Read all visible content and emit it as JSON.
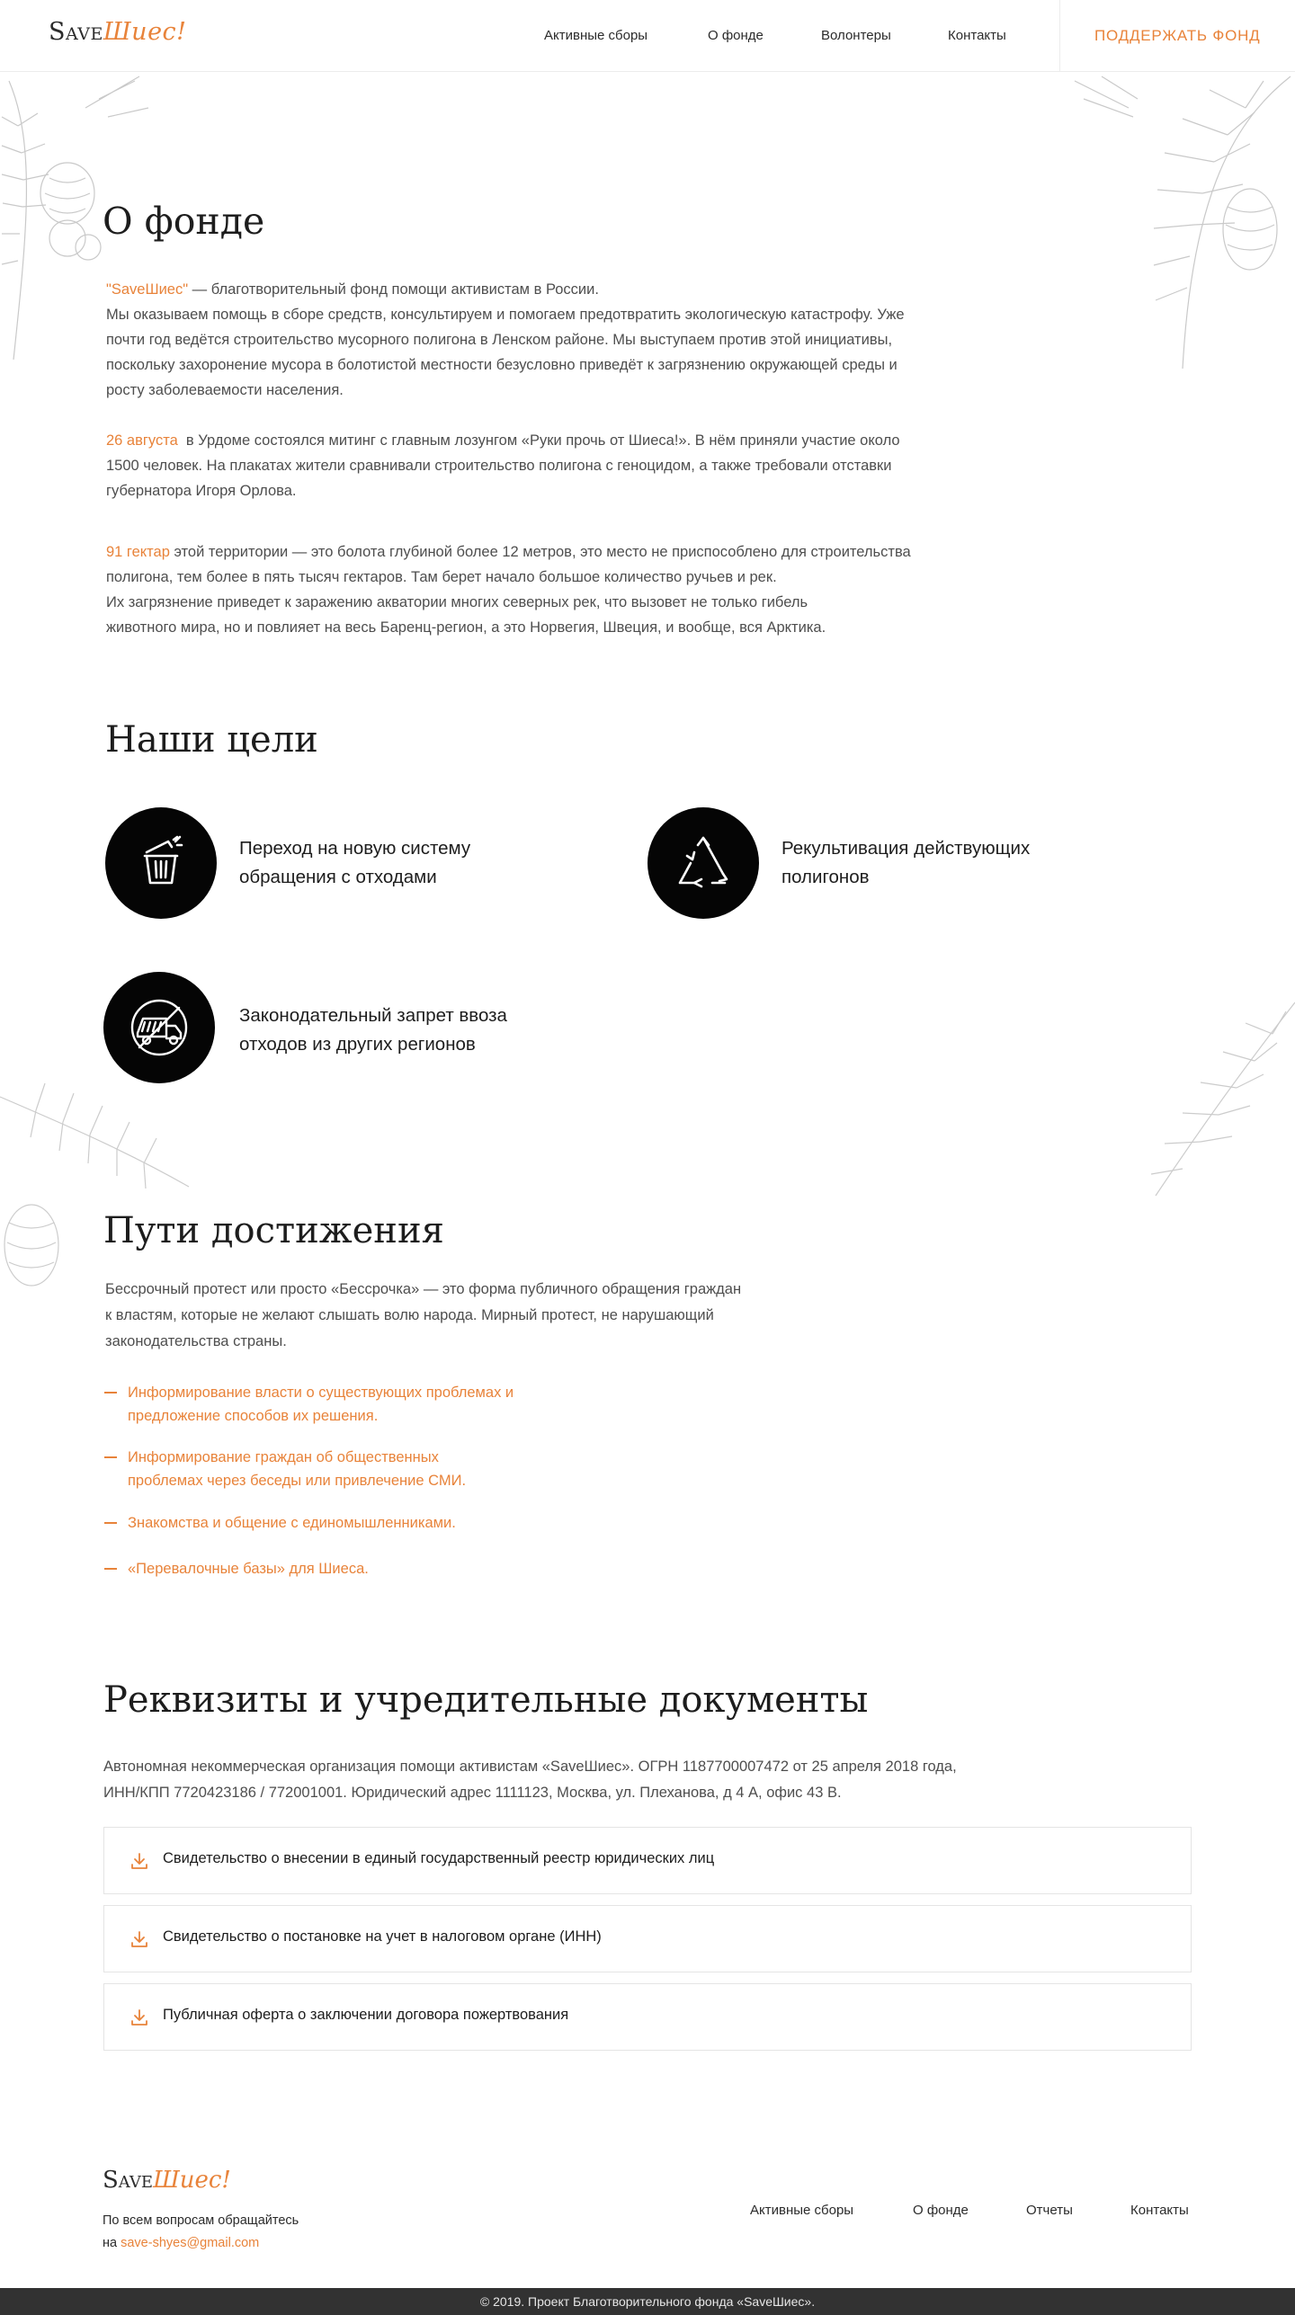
{
  "header": {
    "logo_part1": "Save",
    "logo_part2": "Шиес!",
    "nav": [
      "Активные сборы",
      "О фонде",
      "Волонтеры",
      "Контакты"
    ],
    "support_label": "ПОДДЕРЖАТЬ ФОНД"
  },
  "about": {
    "title": "О фонде",
    "p1_highlight": "\"SaveШиес\"",
    "p1_text": " — благотворительный фонд помощи активистам в России.",
    "p1_lines": [
      "Мы оказываем помощь в сборе средств, консультируем и помогаем предотвратить экологическую катастрофу. Уже",
      "почти год ведётся строительство мусорного полигона в Ленском районе. Мы выступаем против этой инициативы,",
      "поскольку захоронение мусора в болотистой местности безусловно приведёт к загрязнению окружающей среды и",
      "росту заболеваемости населения."
    ],
    "p2_highlight": "26 августа",
    "p2_first": "  в Урдоме состоялся митинг с главным лозунгом «Руки прочь от Шиеса!». В нём приняли участие около",
    "p2_lines": [
      "1500 человек. На плакатах жители сравнивали строительство полигона с геноцидом, а также требовали отставки",
      "губернатора Игоря Орлова."
    ],
    "p3_highlight": "91 гектар",
    "p3_first": " этой территории — это болота глубиной более 12 метров, это место не приспособлено для строительства",
    "p3_lines": [
      "полигона, тем более в пять тысяч гектаров. Там берет начало большое количество ручьев и рек.",
      "Их загрязнение приведет к заражению акватории многих северных рек, что вызовет не только гибель",
      "животного мира, но и повлияет на весь Баренц-регион, а это Норвегия, Швеция, и вообще, вся Арктика."
    ]
  },
  "goals": {
    "title": "Наши цели",
    "items": [
      {
        "line1": "Переход на новую систему",
        "line2": "обращения с отходами",
        "icon": "trash-bin-icon"
      },
      {
        "line1": "Рекультивация действующих",
        "line2": "полигонов",
        "icon": "recycle-icon"
      },
      {
        "line1": "Законодательный запрет ввоза",
        "line2": "отходов из других регионов",
        "icon": "no-truck-icon"
      }
    ]
  },
  "ways": {
    "title": "Пути достижения",
    "intro_lines": [
      "Бессрочный протест или просто «Бессрочка» — это форма публичного обращения граждан",
      "к властям, которые не желают слышать волю народа. Мирный протест, не нарушающий",
      "законодательства страны."
    ],
    "items": [
      {
        "line1": "Информирование власти о существующих проблемах и",
        "line2": "предложение способов их решения."
      },
      {
        "line1": "Информирование граждан об общественных",
        "line2": "проблемах через беседы или привлечение СМИ."
      },
      {
        "line1": "Знакомства и общение с единомышленниками.",
        "line2": ""
      },
      {
        "line1": "«Перевалочные базы» для Шиеса.",
        "line2": ""
      }
    ]
  },
  "requisites": {
    "title": "Реквизиты и учредительные документы",
    "lines": [
      "Автономная некоммерческая организация помощи активистам «SaveШиес». ОГРН 1187700007472 от 25 апреля 2018 года,",
      "ИНН/КПП 7720423186 / 772001001. Юридический адрес 1111123, Москва, ул. Плеханова, д 4 А, офис 43 В."
    ],
    "documents": [
      "Свидетельство о внесении в единый государственный реестр юридических лиц",
      "Свидетельство о постановке на учет в налоговом органе (ИНН)",
      "Публичная оферта о заключении договора пожертвования"
    ]
  },
  "footer": {
    "logo_part1": "Save",
    "logo_part2": "Шиес!",
    "contact_line1": "По всем вопросам обращайтесь",
    "contact_prefix": "на ",
    "email": "save-shyes@gmail.com",
    "nav": [
      "Активные сборы",
      "О фонде",
      "Отчеты",
      "Контакты"
    ],
    "copyright": "© 2019. Проект Благотворительного фонда «SaveШиес»."
  },
  "colors": {
    "accent": "#e8833a",
    "text": "#4e4e4e",
    "heading": "#1d1d1d",
    "footer_bar": "#323232"
  }
}
